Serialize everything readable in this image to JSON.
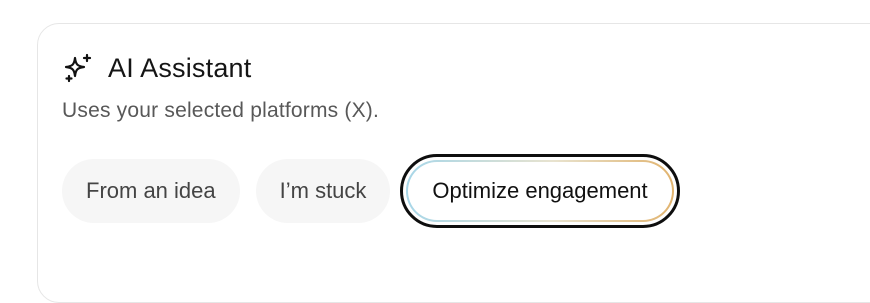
{
  "assistant": {
    "icon": "sparkle-icon",
    "title": "AI Assistant",
    "subtitle": "Uses your selected platforms (X)."
  },
  "chips": [
    {
      "label": "From an idea",
      "selected": false
    },
    {
      "label": "I’m stuck",
      "selected": false
    },
    {
      "label": "Optimize engagement",
      "selected": true
    }
  ],
  "colors": {
    "text_primary": "#151515",
    "text_secondary": "#585858",
    "chip_bg": "#f6f6f6",
    "selected_outline": "#0e0e0e",
    "selected_gradient_start": "#a7d6e8",
    "selected_gradient_end": "#e1b36e"
  }
}
